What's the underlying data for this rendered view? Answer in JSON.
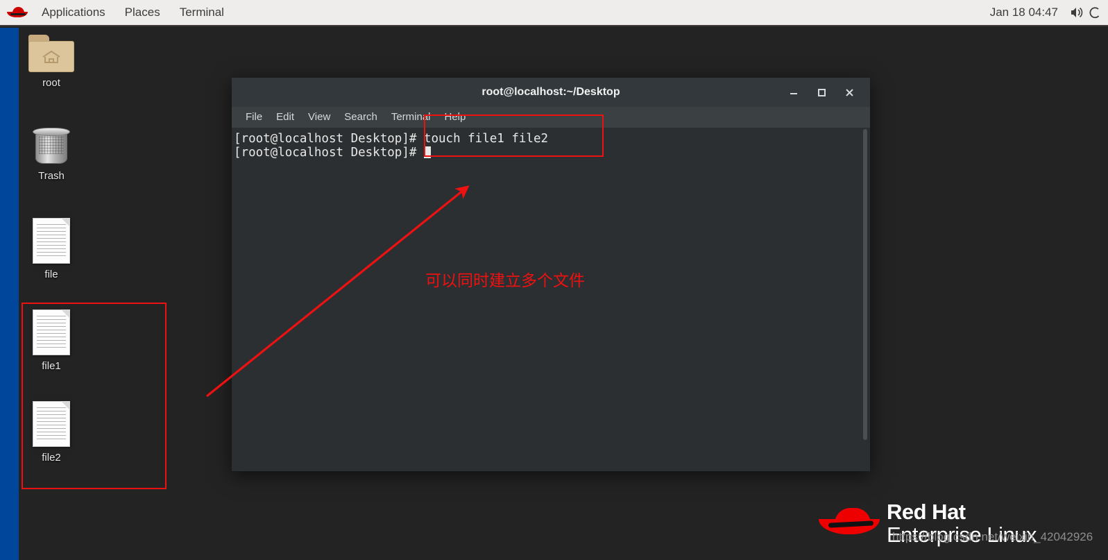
{
  "colors": {
    "desktop_bg": "#232323",
    "left_stripe": "#00479b",
    "panel_bg": "#eeedeb",
    "terminal_bg": "#2b2f31",
    "titlebar_bg": "#32383b",
    "menubar_bg": "#3b4042",
    "annotation_red": "#ee1111",
    "redhat_red": "#ee0000"
  },
  "top_panel": {
    "logo_icon": "redhat-logo-icon",
    "items": [
      {
        "label": "Applications"
      },
      {
        "label": "Places"
      },
      {
        "label": "Terminal"
      }
    ],
    "clock": "Jan 18 04:47",
    "volume_icon": "volume-icon",
    "power_icon": "power-icon"
  },
  "desktop_icons": [
    {
      "name": "root",
      "label": "root",
      "icon": "home-folder-icon"
    },
    {
      "name": "trash",
      "label": "Trash",
      "icon": "trash-icon"
    },
    {
      "name": "file",
      "label": "file",
      "icon": "document-icon"
    },
    {
      "name": "file1",
      "label": "file1",
      "icon": "document-icon"
    },
    {
      "name": "file2",
      "label": "file2",
      "icon": "document-icon"
    }
  ],
  "terminal": {
    "title": "root@localhost:~/Desktop",
    "menus": [
      {
        "label": "File"
      },
      {
        "label": "Edit"
      },
      {
        "label": "View"
      },
      {
        "label": "Search"
      },
      {
        "label": "Terminal"
      },
      {
        "label": "Help"
      }
    ],
    "window_buttons": {
      "minimize": "—",
      "maximize": "□",
      "close": "✕"
    },
    "lines": [
      "[root@localhost Desktop]# touch file1 file2",
      "[root@localhost Desktop]# "
    ],
    "prompt": "[root@localhost Desktop]# ",
    "command": "touch file1 file2"
  },
  "annotations": {
    "note_text": "可以同时建立多个文件",
    "box_command_label": "command-highlight-box",
    "box_files_label": "files-highlight-box",
    "arrow_label": "pointer-arrow"
  },
  "brand": {
    "line1": "Red Hat",
    "line2": "Enterprise Linux"
  },
  "watermark": "https://blog.csdn.net/weixin_42042926"
}
